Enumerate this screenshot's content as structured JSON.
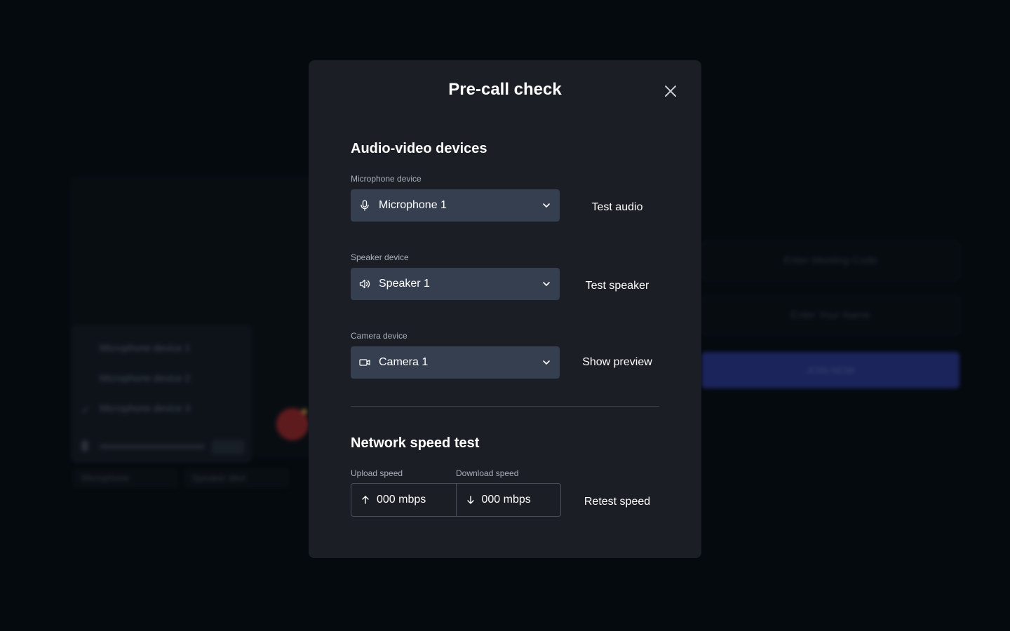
{
  "background": {
    "dropdown_items": [
      "Microphone device 1",
      "Microphone device 2",
      "Microphone device 3"
    ],
    "bottom_controls": [
      "Microphone",
      "Speaker devi"
    ],
    "meeting_code_placeholder": "Enter Meeting Code",
    "name_placeholder": "Enter Your Name",
    "join_label": "JOIN NOW"
  },
  "modal": {
    "title": "Pre-call check",
    "close_icon": "close-icon",
    "av_section": {
      "title": "Audio-video devices",
      "microphone": {
        "label": "Microphone device",
        "value": "Microphone 1",
        "icon": "microphone-icon",
        "action": "Test audio"
      },
      "speaker": {
        "label": "Speaker device",
        "value": "Speaker 1",
        "icon": "speaker-icon",
        "action": "Test speaker"
      },
      "camera": {
        "label": "Camera device",
        "value": "Camera 1",
        "icon": "camera-icon",
        "action": "Show preview"
      }
    },
    "network_section": {
      "title": "Network speed test",
      "upload_label": "Upload speed",
      "upload_value": "000 mbps",
      "download_label": "Download speed",
      "download_value": "000 mbps",
      "action": "Retest speed"
    }
  },
  "colors": {
    "backdrop": "#050a0f",
    "modal_bg": "#1b1e25",
    "select_bg": "#363f50",
    "join_accent": "#2e3a99",
    "end_call": "#a82a2a"
  }
}
